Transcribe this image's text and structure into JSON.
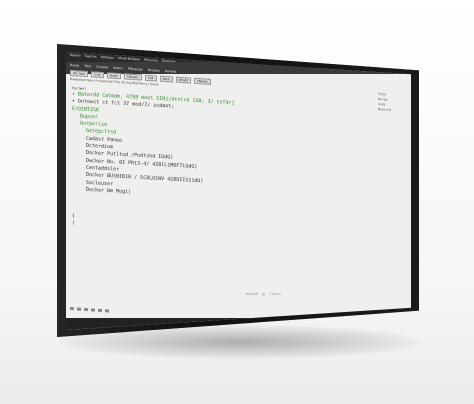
{
  "screen": {
    "topbar_items": [
      "Dabian",
      "Dasciirs",
      "Vebstsys",
      "Sfrvat Mnllsiae",
      "Pstuyoog",
      "Fentinder"
    ],
    "menu_items": [
      "Hoyse",
      "Tolst",
      "Cnrsatw",
      "Nrsms",
      "Ffleranser",
      "Nrssaes",
      "Yoolbnk"
    ],
    "tabs": [
      "Filn Tast",
      "Cvbl",
      "Nutst",
      "Tdbssnc",
      "Fdit",
      "Nsrb",
      "Nfrabt",
      "Sfwsbe"
    ],
    "address_text": "Bawdatord Naor Pnmqtomsf Fhhs Tcclmy Bod Nmry | Sanst",
    "address_sub": "Tnasmt Bkbg awre. Sudd/ Nrn",
    "right_panel": [
      "Ttnttr",
      "Nsl  bp",
      "Snds",
      "Bosd tnd"
    ],
    "lines": [
      {
        "text": "Hsk Nmfl",
        "style": "small"
      },
      {
        "text": "✦ Batordd Catmam, 4798 meet SIN1/dtnlrd 1S0; 3/ ssfdrj",
        "style": "green"
      },
      {
        "text": "✦ bntowst ct fct 37 mod/7/ scdant;",
        "style": "dark"
      },
      {
        "text": "ErOINTZSK",
        "style": "green"
      },
      {
        "text": "Dupser",
        "style": "green-i1"
      },
      {
        "text": "Ourperise",
        "style": "green-i1"
      },
      {
        "text": "Getepcltsd",
        "style": "green-i2"
      },
      {
        "text": "Cadast Paneo",
        "style": "dark-i2"
      },
      {
        "text": "Dcterdiom",
        "style": "dark-i2"
      },
      {
        "text": "Docker Putltud /Podtshd IUdG)",
        "style": "dark-i2"
      },
      {
        "text": "Dwcker No. 0I PR13-4/ 428lL1MOF7LUdG)",
        "style": "dark-i2"
      },
      {
        "text": "Centaddsler",
        "style": "dark-i2"
      },
      {
        "text": "Docker BUS0IB10 / SC8LU1WV 428OIIS11dU)",
        "style": "dark-i2"
      },
      {
        "text": "Socleuser",
        "style": "dark-i2"
      },
      {
        "text": "Docker Bm Mogl)",
        "style": "dark-i2"
      },
      {
        "text": "{",
        "style": "dark-gap"
      },
      {
        "text": "(",
        "style": "dark"
      }
    ]
  },
  "brand": {
    "left": "Nlogdat",
    "right": "Cuboru"
  }
}
